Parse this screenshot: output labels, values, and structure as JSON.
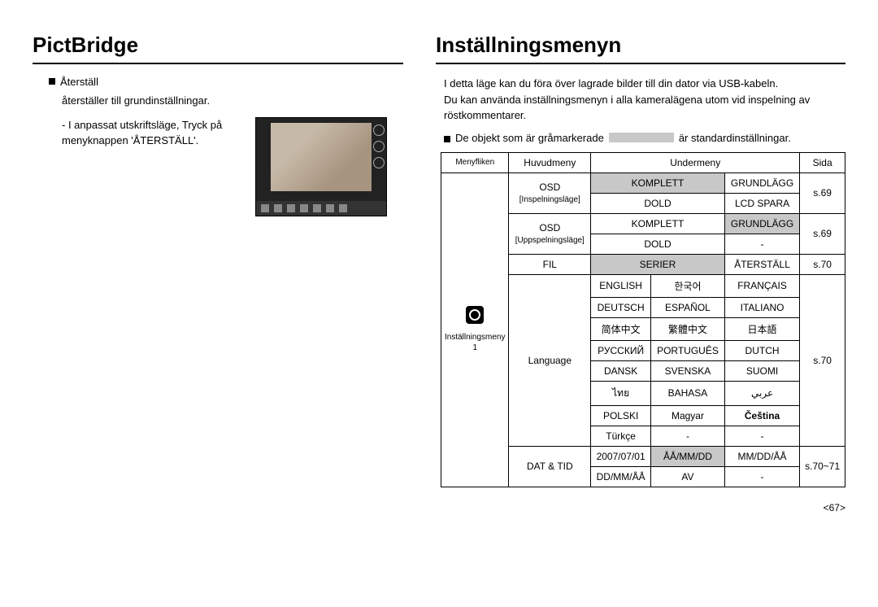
{
  "left": {
    "title": "PictBridge",
    "reset_label": "Återställ",
    "reset_desc": "återställer till grundinställningar.",
    "reset_instruction": "- I anpassat utskriftsläge, Tryck på menyknappen 'ÅTERSTÄLL'."
  },
  "right": {
    "title": "Inställningsmenyn",
    "intro1": "I detta läge kan du föra över lagrade bilder till din dator via USB-kabeln.",
    "intro2": "Du kan använda inställningsmenyn i alla kameralägena utom vid inspelning av röstkommentarer.",
    "legend_prefix": "De objekt som är gråmarkerade",
    "legend_suffix": "är standardinställningar.",
    "headers": {
      "tab": "Menyfliken",
      "main": "Huvudmeny",
      "sub": "Undermeny",
      "page": "Sida"
    },
    "tab_label_a": "Inställningsmeny",
    "tab_label_b": "1",
    "rows": {
      "osd_rec_label_a": "OSD",
      "osd_rec_label_b": "[Inspelningsläge]",
      "osd_rec": {
        "c1": "KOMPLETT",
        "c2": "GRUNDLÄGG",
        "c3": "DOLD",
        "c4": "LCD SPARA",
        "page": "s.69"
      },
      "osd_play_label_a": "OSD",
      "osd_play_label_b": "[Uppspelningsläge]",
      "osd_play": {
        "c1": "KOMPLETT",
        "c2": "GRUNDLÄGG",
        "c3": "DOLD",
        "c4": "-",
        "page": "s.69"
      },
      "fil": {
        "label": "FIL",
        "c1": "SERIER",
        "c2": "ÅTERSTÄLL",
        "page": "s.70"
      },
      "lang": {
        "label": "Language",
        "r1": [
          "ENGLISH",
          "한국어",
          "FRANÇAIS"
        ],
        "r2": [
          "DEUTSCH",
          "ESPAÑOL",
          "ITALIANO"
        ],
        "r3": [
          "简体中文",
          "繁體中文",
          "日本語"
        ],
        "r4": [
          "РУССКИЙ",
          "PORTUGUÊS",
          "DUTCH"
        ],
        "r5": [
          "DANSK",
          "SVENSKA",
          "SUOMI"
        ],
        "r6": [
          "ไทย",
          "BAHASA",
          "عربي"
        ],
        "r7": [
          "POLSKI",
          "Magyar",
          "Čeština"
        ],
        "r8": [
          "Türkçe",
          "-",
          "-"
        ],
        "page": "s.70"
      },
      "date": {
        "label": "DAT & TID",
        "r1": [
          "2007/07/01",
          "ÅÅ/MM/DD",
          "MM/DD/ÅÅ"
        ],
        "r2": [
          "DD/MM/ÅÅ",
          "AV",
          "-"
        ],
        "page": "s.70~71"
      }
    }
  },
  "pagenum": "<67>"
}
